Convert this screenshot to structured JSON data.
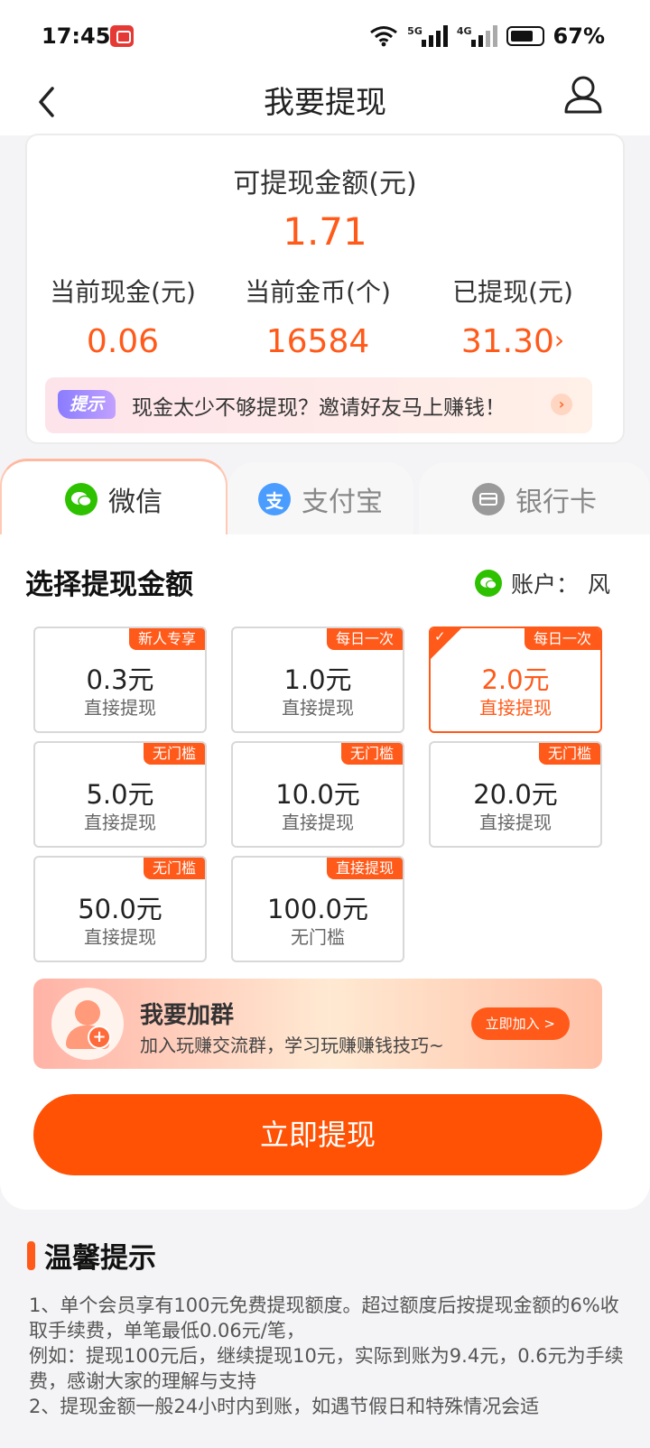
{
  "status_bar": {
    "time": "17:45",
    "net1": "5G",
    "net2": "4G",
    "battery": "67%"
  },
  "nav": {
    "title": "我要提现"
  },
  "balance": {
    "label": "可提现金额(元)",
    "amount": "1.71",
    "stats": [
      {
        "label": "当前现金(元)",
        "value": "0.06"
      },
      {
        "label": "当前金币(个)",
        "value": "16584"
      },
      {
        "label": "已提现(元)",
        "value": "31.30",
        "arrow": "›"
      }
    ],
    "tip": {
      "badge": "提示",
      "text": "现金太少不够提现？邀请好友马上赚钱！",
      "arrow": "›"
    }
  },
  "tabs": [
    {
      "label": "微信",
      "icon": "wechat-icon",
      "color": "#2dc100",
      "active": true
    },
    {
      "label": "支付宝",
      "icon": "alipay-icon",
      "color": "#4a9dff",
      "active": false
    },
    {
      "label": "银行卡",
      "icon": "bank-card-icon",
      "color": "#9a9a9a",
      "active": false
    }
  ],
  "withdraw": {
    "title": "选择提现金额",
    "account_label": "账户：",
    "account_name": "风",
    "options": [
      {
        "badge": "新人专享",
        "amount": "0.3元",
        "sub": "直接提现",
        "selected": false
      },
      {
        "badge": "每日一次",
        "amount": "1.0元",
        "sub": "直接提现",
        "selected": false
      },
      {
        "badge": "每日一次",
        "amount": "2.0元",
        "sub": "直接提现",
        "selected": true
      },
      {
        "badge": "无门槛",
        "amount": "5.0元",
        "sub": "直接提现",
        "selected": false
      },
      {
        "badge": "无门槛",
        "amount": "10.0元",
        "sub": "直接提现",
        "selected": false
      },
      {
        "badge": "无门槛",
        "amount": "20.0元",
        "sub": "直接提现",
        "selected": false
      },
      {
        "badge": "无门槛",
        "amount": "50.0元",
        "sub": "直接提现",
        "selected": false
      },
      {
        "badge": "直接提现",
        "amount": "100.0元",
        "sub": "无门槛",
        "selected": false
      }
    ],
    "selected_mark": "✓"
  },
  "group": {
    "title": "我要加群",
    "subtitle": "加入玩赚交流群，学习玩赚赚钱技巧~",
    "button": "立即加入 >",
    "plus": "+"
  },
  "submit": {
    "label": "立即提现"
  },
  "tips": {
    "title": "温馨提示",
    "lines": [
      "1、单个会员享有100元免费提现额度。超过额度后按提现金额的6%收取手续费，单笔最低0.06元/笔，",
      "例如：提现100元后，继续提现10元，实际到账为9.4元，0.6元为手续费，感谢大家的理解与支持",
      "2、提现金额一般24小时内到账，如遇节假日和特殊情况会适"
    ]
  },
  "colors": {
    "accent": "#ff5a1a",
    "button": "#ff5205",
    "wechat": "#2dc100"
  }
}
